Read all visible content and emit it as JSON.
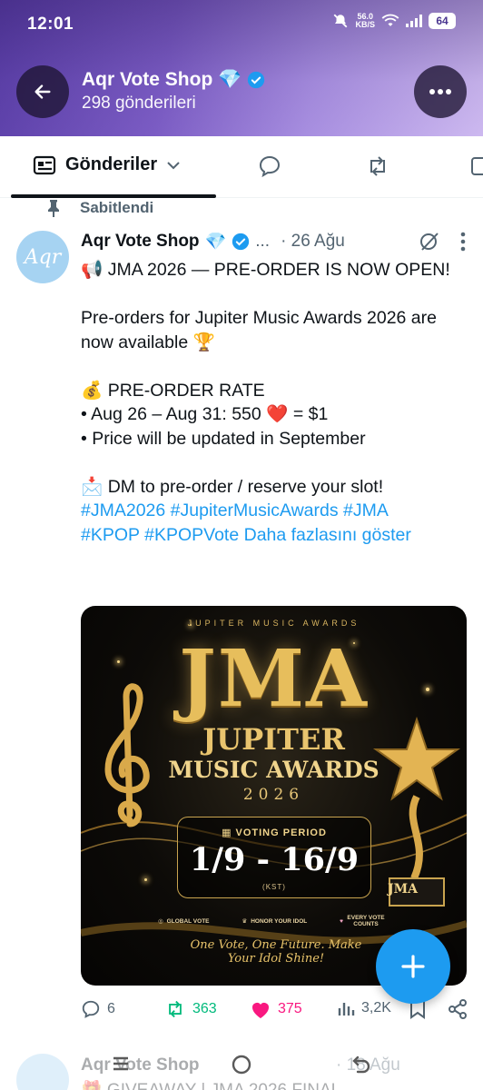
{
  "status_bar": {
    "time": "12:01",
    "net_speed_value": "56.0",
    "net_speed_unit": "KB/S",
    "battery": "64"
  },
  "profile": {
    "name": "Aqr Vote Shop",
    "posts_count": "298 gönderileri"
  },
  "tabs": {
    "active_label": "Gönderiler"
  },
  "pinned": {
    "label": "Sabitlendi"
  },
  "tweet": {
    "author": "Aqr Vote Shop",
    "avatar_text": "Aqr",
    "ellipsis": "...",
    "date": "· 26 Ağu",
    "body": "📢 JMA 2026 — PRE-ORDER IS NOW OPEN!\n\nPre-orders for Jupiter Music Awards 2026 are now available 🏆\n\n💰 PRE-ORDER RATE\n• Aug 26 – Aug 31: 550 ❤️ = $1\n• Price will be updated in September\n\n📩 DM to pre-order / reserve your slot!\n",
    "hashtags": [
      "#JMA2026",
      "#JupiterMusicAwards",
      "#JMA",
      "#KPOP",
      "#KPOPVote"
    ],
    "show_more": "Daha fazlasını göster"
  },
  "poster": {
    "kicker": "JUPITER MUSIC AWARDS",
    "big_title": "JMA",
    "line1": "JUPITER",
    "line2": "MUSIC AWARDS",
    "year": "2026",
    "voting_period_label": "VOTING PERIOD",
    "dates": "1/9 - 16/9",
    "timezone": "(KST)",
    "feature1": "GLOBAL VOTE",
    "feature2": "HONOR YOUR IDOL",
    "feature3": "EVERY VOTE COUNTS",
    "slogan": "One Vote, One Future. Make Your Idol Shine!",
    "trophy_text": "JMA"
  },
  "actions": {
    "replies": "6",
    "reposts": "363",
    "likes": "375",
    "views": "3,2K"
  },
  "next_tweet": {
    "author": "Aqr Vote Shop",
    "date": "· 18 Ağu",
    "line": "🎁 GIVEAWAY | JMA 2026 FINAL"
  },
  "colors": {
    "accent": "#1d9bf0",
    "repost": "#00ba7c",
    "like": "#f91880",
    "muted": "#536471"
  }
}
